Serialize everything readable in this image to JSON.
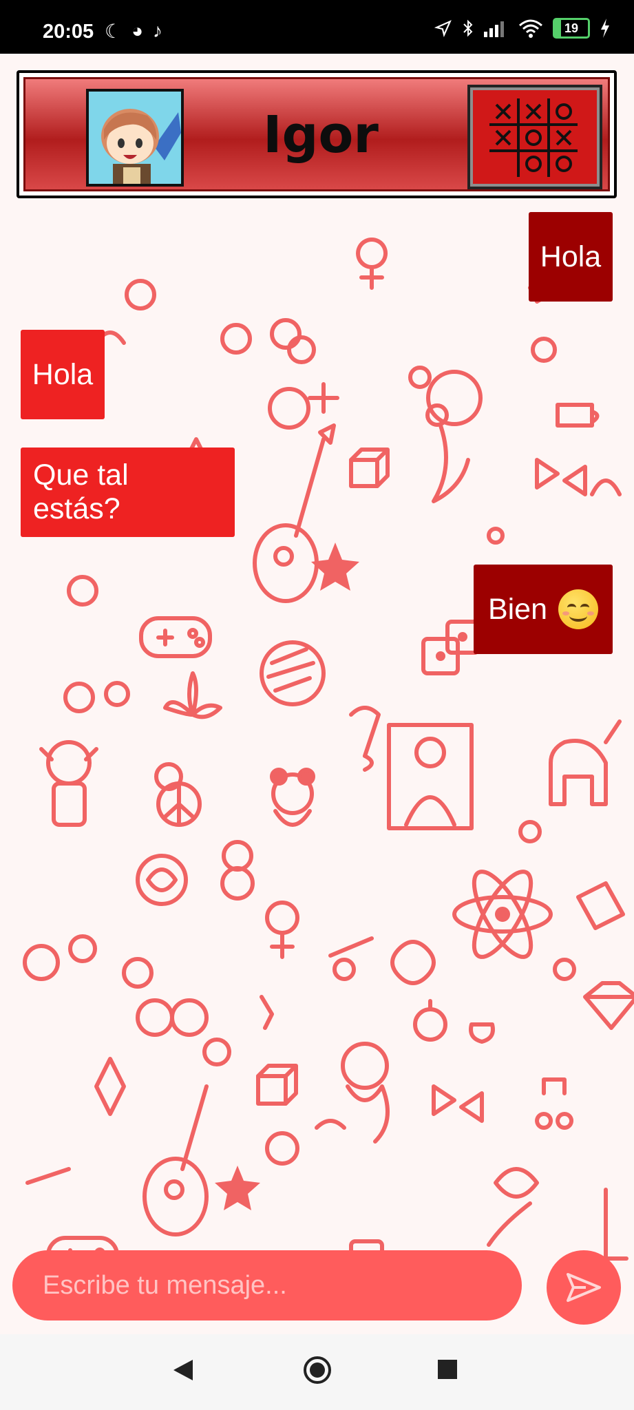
{
  "status_bar": {
    "time": "20:05",
    "battery_level": "19",
    "battery_percent": 19,
    "left_icons": [
      "moon-icon",
      "app-icon",
      "tiktok-icon"
    ],
    "right_icons": [
      "location-icon",
      "bluetooth-icon",
      "signal-icon",
      "wifi-icon",
      "battery-icon",
      "charging-icon"
    ]
  },
  "header": {
    "contact_name": "Igor",
    "avatar_icon": "anime-avatar",
    "game_button_icon": "tic-tac-toe-icon",
    "tic_tac_toe_cells": [
      "x",
      "x",
      "o",
      "x",
      "o",
      "x",
      "",
      "o",
      "o"
    ]
  },
  "messages": [
    {
      "text": "Hola",
      "direction": "sent"
    },
    {
      "text": "Hola",
      "direction": "received"
    },
    {
      "text": "Que tal estás?",
      "direction": "received"
    },
    {
      "text": "Bien",
      "direction": "sent",
      "emoji": "smiling-face-emoji"
    }
  ],
  "composer": {
    "placeholder": "Escribe tu mensaje...",
    "send_icon": "send-icon"
  },
  "colors": {
    "sent_bubble": "#9c0000",
    "received_bubble": "#ee2222",
    "accent": "#ff5c5c",
    "pattern": "#ee4a4a"
  },
  "nav_bar": {
    "icons": [
      "back-icon",
      "home-icon",
      "recents-icon"
    ]
  }
}
